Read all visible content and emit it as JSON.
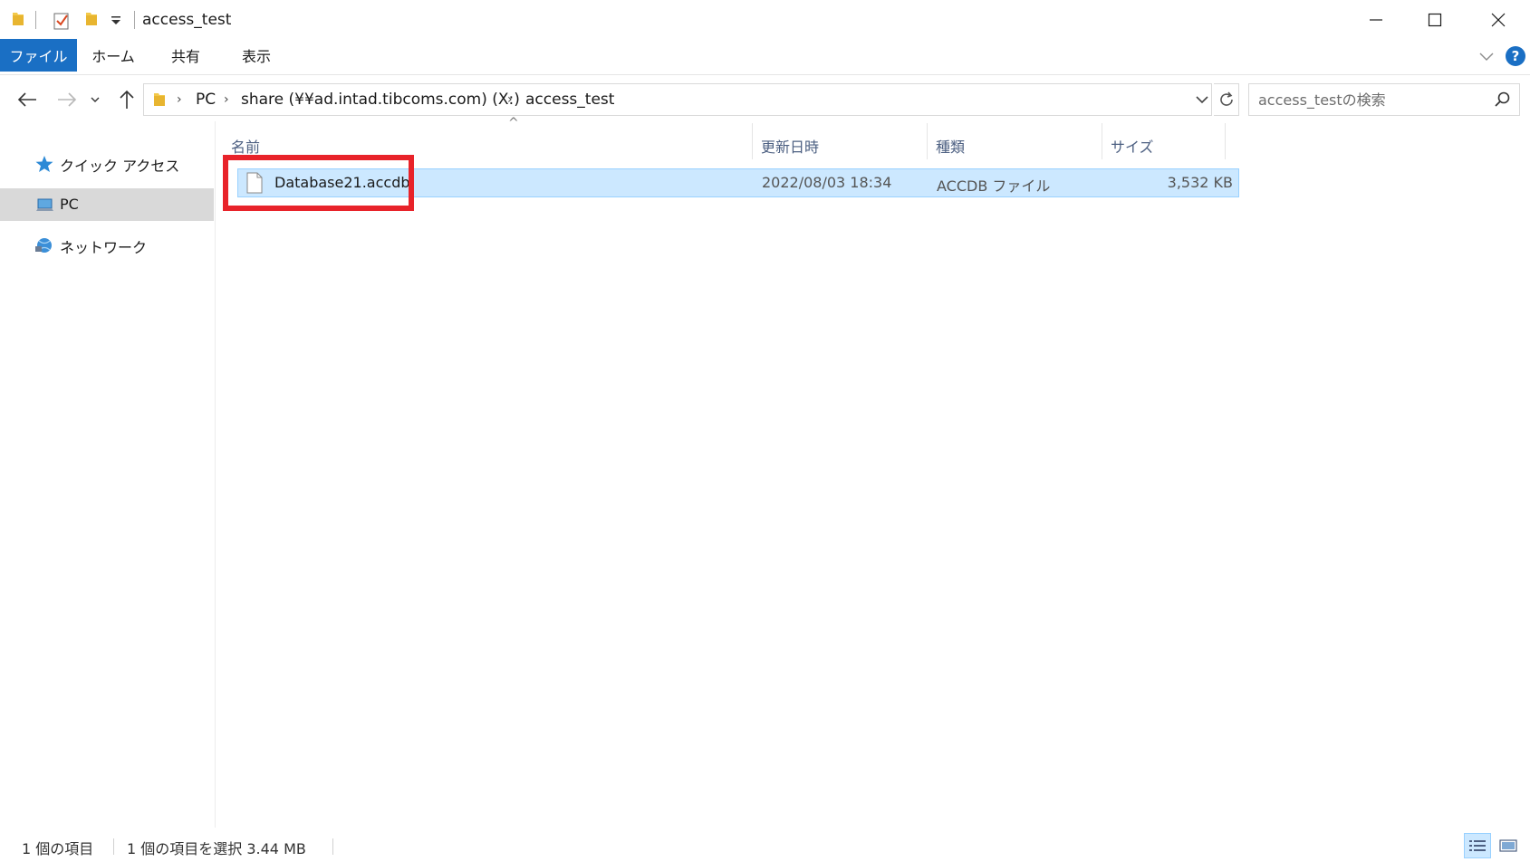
{
  "window": {
    "title": "access_test"
  },
  "ribbon": {
    "tabs": [
      "ファイル",
      "ホーム",
      "共有",
      "表示"
    ],
    "help_label": "?"
  },
  "address": {
    "crumbs": [
      "PC",
      "share (¥¥ad.intad.tibcoms.com) (X:)",
      "access_test"
    ]
  },
  "search": {
    "placeholder": "access_testの検索"
  },
  "navpane": {
    "items": [
      {
        "label": "クイック アクセス",
        "icon": "star-icon"
      },
      {
        "label": "PC",
        "icon": "pc-icon",
        "selected": true
      },
      {
        "label": "ネットワーク",
        "icon": "network-icon"
      }
    ]
  },
  "columns": {
    "name": "名前",
    "modified": "更新日時",
    "type": "種類",
    "size": "サイズ"
  },
  "files": [
    {
      "name": "Database21.accdb",
      "modified": "2022/08/03 18:34",
      "type": "ACCDB ファイル",
      "size": "3,532 KB"
    }
  ],
  "status": {
    "count": "1 個の項目",
    "selection": "1 個の項目を選択  3.44 MB"
  },
  "colors": {
    "accent": "#1a6fc4",
    "selection_bg": "#cce8ff",
    "highlight_border": "#e8232a"
  }
}
